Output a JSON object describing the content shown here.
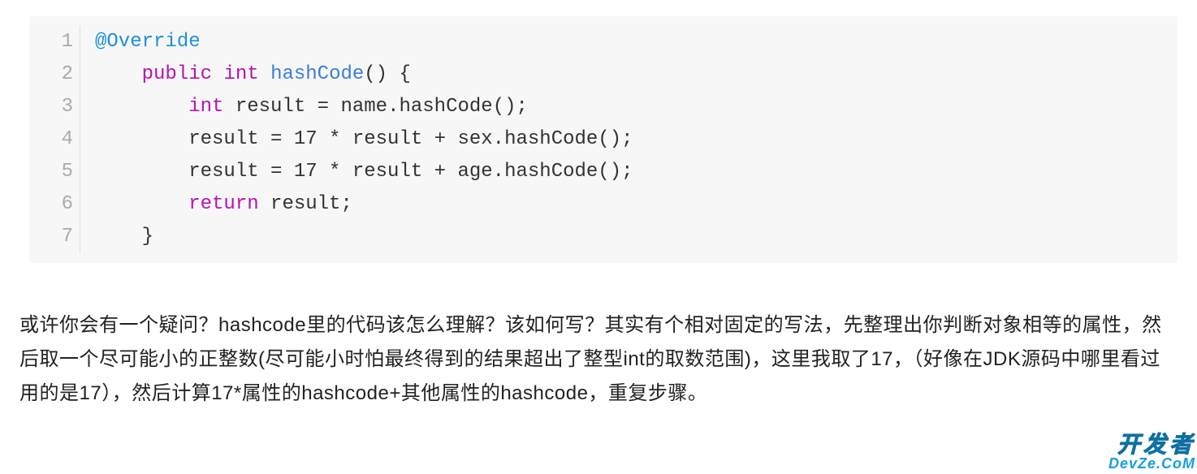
{
  "code": {
    "lines": [
      {
        "n": "1",
        "segments": [
          {
            "cls": "tok-annotation",
            "text": "@Override"
          }
        ]
      },
      {
        "n": "2",
        "segments": [
          {
            "cls": "tok-plain",
            "text": "    "
          },
          {
            "cls": "tok-keyword",
            "text": "public"
          },
          {
            "cls": "tok-plain",
            "text": " "
          },
          {
            "cls": "tok-keyword",
            "text": "int"
          },
          {
            "cls": "tok-plain",
            "text": " "
          },
          {
            "cls": "tok-func",
            "text": "hashCode"
          },
          {
            "cls": "tok-plain",
            "text": "() {"
          }
        ]
      },
      {
        "n": "3",
        "segments": [
          {
            "cls": "tok-plain",
            "text": "        "
          },
          {
            "cls": "tok-keyword",
            "text": "int"
          },
          {
            "cls": "tok-plain",
            "text": " result = name.hashCode();"
          }
        ]
      },
      {
        "n": "4",
        "segments": [
          {
            "cls": "tok-plain",
            "text": "        result = 17 * result + sex.hashCode();"
          }
        ]
      },
      {
        "n": "5",
        "segments": [
          {
            "cls": "tok-plain",
            "text": "        result = 17 * result + age.hashCode();"
          }
        ]
      },
      {
        "n": "6",
        "segments": [
          {
            "cls": "tok-plain",
            "text": "        "
          },
          {
            "cls": "tok-keyword",
            "text": "return"
          },
          {
            "cls": "tok-plain",
            "text": " result;"
          }
        ]
      },
      {
        "n": "7",
        "segments": [
          {
            "cls": "tok-plain",
            "text": "    }"
          }
        ]
      }
    ]
  },
  "paragraph": {
    "text": "  或许你会有一个疑问？hashcode里的代码该怎么理解？该如何写？其实有个相对固定的写法，先整理出你判断对象相等的属性，然后取一个尽可能小的正整数(尽可能小时怕最终得到的结果超出了整型int的取数范围)，这里我取了17，（好像在JDK源码中哪里看过用的是17），然后计算17*属性的hashcode+其他属性的hashcode，重复步骤。"
  },
  "watermark": {
    "top": "开发者",
    "bottom": "DevZe.CoM"
  }
}
